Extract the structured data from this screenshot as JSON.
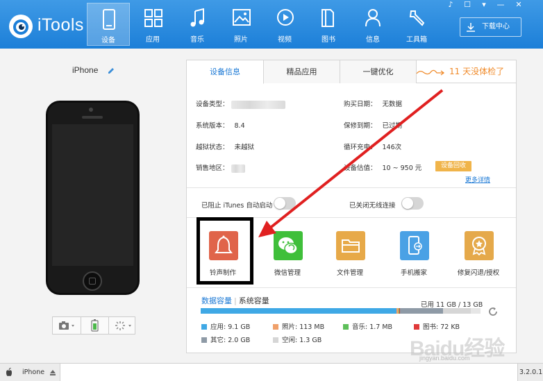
{
  "app": {
    "name": "iTools"
  },
  "nav": [
    {
      "label": "设备",
      "icon": "phone-icon",
      "active": true
    },
    {
      "label": "应用",
      "icon": "apps-grid-icon",
      "active": false
    },
    {
      "label": "音乐",
      "icon": "music-note-icon",
      "active": false
    },
    {
      "label": "照片",
      "icon": "photo-icon",
      "active": false
    },
    {
      "label": "视频",
      "icon": "play-circle-icon",
      "active": false
    },
    {
      "label": "图书",
      "icon": "book-icon",
      "active": false
    },
    {
      "label": "信息",
      "icon": "person-icon",
      "active": false
    },
    {
      "label": "工具箱",
      "icon": "wrench-icon",
      "active": false
    }
  ],
  "window_controls": [
    "♪",
    "☐",
    "▾",
    "—",
    "✕"
  ],
  "download": {
    "label": "下载中心"
  },
  "device": {
    "name": "iPhone"
  },
  "tabs": [
    {
      "label": "设备信息",
      "active": true
    },
    {
      "label": "精品应用",
      "active": false
    },
    {
      "label": "一键优化",
      "active": false
    }
  ],
  "health_note": "11 天没体检了",
  "info": {
    "left": [
      {
        "key": "设备类型：",
        "value": ""
      },
      {
        "key": "系统版本：",
        "value": "8.4"
      },
      {
        "key": "越狱状态：",
        "value": "未越狱"
      },
      {
        "key": "销售地区：",
        "value": ""
      }
    ],
    "right": [
      {
        "key": "购买日期：",
        "value": "无数据"
      },
      {
        "key": "保修到期：",
        "value": "已过期"
      },
      {
        "key": "循环充电：",
        "value": "146次"
      },
      {
        "key": "设备估值：",
        "value": "10 ~ 950 元"
      }
    ],
    "recycle_button": "设备回收",
    "more_link": "更多详情"
  },
  "toggles": [
    {
      "label": "已阻止 iTunes 自动启动",
      "on": false
    },
    {
      "label": "已关闭无线连接",
      "on": false
    }
  ],
  "tools": [
    {
      "label": "铃声制作",
      "icon": "bell-icon",
      "color": "#e0644a"
    },
    {
      "label": "微信管理",
      "icon": "wechat-icon",
      "color": "#3fbf3a"
    },
    {
      "label": "文件管理",
      "icon": "folder-icon",
      "color": "#e7a948"
    },
    {
      "label": "手机搬家",
      "icon": "phone-transfer-icon",
      "color": "#4aa1e5"
    },
    {
      "label": "修复闪退/授权",
      "icon": "medal-icon",
      "color": "#e5a94a"
    }
  ],
  "capacity": {
    "tab_data": "数据容量",
    "tab_system": "系统容量",
    "used_text": "已用 11 GB / 13 GB",
    "used_fraction": 0.846,
    "segments": [
      {
        "label": "应用: 9.1 GB",
        "color": "#3fa8e5",
        "fraction": 0.7
      },
      {
        "label": "照片: 113 MB",
        "color": "#f0a06a",
        "fraction": 0.008
      },
      {
        "label": "音乐: 1.7 MB",
        "color": "#5dbf5a",
        "fraction": 0.001
      },
      {
        "label": "图书: 72 KB",
        "color": "#e03a3a",
        "fraction": 0.001
      },
      {
        "label": "其它: 2.0 GB",
        "color": "#8e9aa6",
        "fraction": 0.154
      },
      {
        "label": "空闲: 1.3 GB",
        "color": "#d6d6d6",
        "fraction": 0.1
      }
    ]
  },
  "statusbar": {
    "device": "iPhone",
    "version": "3.2.0.1"
  },
  "watermark": {
    "text": "Baidu经验",
    "url": "jingyan.baidu.com"
  }
}
